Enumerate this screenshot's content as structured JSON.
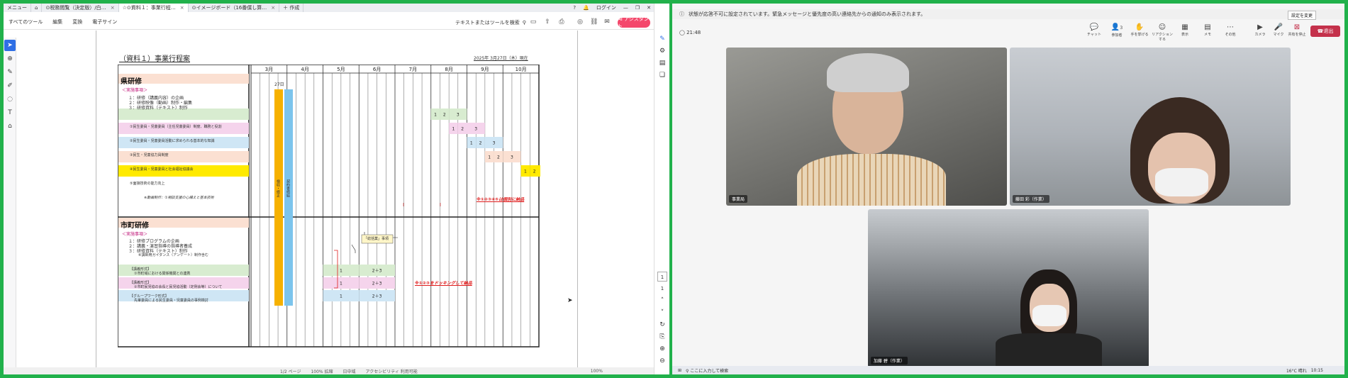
{
  "pdf": {
    "tabs": [
      {
        "label": "メニュー",
        "active": false
      },
      {
        "label": "⊙税務閲覧（決定版）/白…",
        "active": false
      },
      {
        "label": "⊙資料１：事業行程…",
        "active": true
      },
      {
        "label": "⊙イメージボード（16番僕し算…",
        "active": false
      },
      {
        "label": "＋ 作成",
        "active": false
      }
    ],
    "title_right": {
      "login": "ログイン",
      "help": "?"
    },
    "menu": [
      "すべてのツール",
      "編集",
      "変換",
      "電子サイン"
    ],
    "search_placeholder": "テキストまたはツールを検索",
    "ai_button": "AI アシスタント",
    "left_tools": [
      "select-arrow-icon",
      "zoom-icon",
      "pen-icon",
      "highlighter-icon",
      "lasso-icon",
      "text-box-icon",
      "stamp-icon"
    ],
    "status": {
      "page": "1/2 ページ",
      "zoom_a": "100% 拡縮",
      "zoom_b": "100%",
      "scroll": "日中域",
      "area": "アクセシビリティ 利用可能"
    },
    "page_number": "1",
    "page_total": "1",
    "document": {
      "title": "（資料１）事業行程案",
      "date": "2025年 3月27日（木）現在",
      "months": [
        "3月",
        "4月",
        "5月",
        "6月",
        "7月",
        "8月",
        "9月",
        "10月"
      ],
      "marker": "27日",
      "section_a": {
        "title": "県研修",
        "sub": "＜実施事項＞",
        "items": [
          "１：研修（講義内容）の企画",
          "２：研修映像（動画）制作・編集",
          "３：研修資料（テキスト）制作"
        ],
        "rows": [
          {
            "label": "①民生委員・児童委員（主任児童委員）制度、職務と役割",
            "steps": [
              "1",
              "2",
              "3"
            ]
          },
          {
            "label": "②民生委員・児童委員活動に求められる基本的な知識",
            "steps": [
              "1",
              "2",
              "3"
            ]
          },
          {
            "label": "③民生・児童協力員制度",
            "steps": [
              "1",
              "2",
              "3"
            ]
          },
          {
            "label": "④民生委員・児童委員と社会福祉協議会",
            "steps": [
              "1",
              "2",
              "3"
            ]
          },
          {
            "label": "⑤面接技術の能力向上",
            "steps": [
              "1",
              "2",
              "3"
            ]
          }
        ],
        "note": "※動画制作：①相談支援の心構えと基本技術",
        "red_note": "※①②③④⑤は個別に納品"
      },
      "section_b": {
        "title": "市町研修",
        "sub": "＜実施事項＞",
        "items": [
          "１：研修プログラムの企画",
          "２：講義・演習指導の指導者養成",
          "３：研修資料（テキスト）制作"
        ],
        "items_note": "⑥講師用ガイダンス（アンケート）制作含む",
        "callout": "「総括業」事項",
        "rows": [
          {
            "title": "【講義形式】",
            "label": "①市町域における関係機関との連携",
            "steps": [
              "1",
              "2＋3"
            ]
          },
          {
            "title": "【講義形式】",
            "label": "②市町民児協の会長と民児協活動（定例会等）について",
            "steps": [
              "1",
              "2＋3"
            ]
          },
          {
            "title": "【グループワーク形式】",
            "label": "先輩委員による民生委員・児童委員の事例検討",
            "steps": [
              "1",
              "2＋3"
            ]
          }
        ],
        "red_note": "※①②③をドッキングして納品"
      },
      "bars": {
        "a": "検収・修正",
        "b": "契約書締結"
      }
    }
  },
  "teams": {
    "notice": "状態が応答不可に設定されています。緊急メッセージと優先度の高い連絡先からの通知のみ表示されます。",
    "notice_button": "設定を変更",
    "timer": "21:48",
    "controls": [
      {
        "label": "チャット",
        "icon": "chat-icon"
      },
      {
        "label": "参加者",
        "icon": "people-icon"
      },
      {
        "label": "手を挙げる",
        "icon": "hand-icon"
      },
      {
        "label": "リアクションする",
        "icon": "smile-icon"
      },
      {
        "label": "表示",
        "icon": "grid-icon"
      },
      {
        "label": "メモ",
        "icon": "note-icon"
      },
      {
        "label": "その他",
        "icon": "more-icon"
      },
      {
        "label": "カメラ",
        "icon": "camera-icon"
      },
      {
        "label": "マイク",
        "icon": "mic-icon"
      },
      {
        "label": "共有を停止",
        "icon": "share-stop-icon"
      }
    ],
    "participant_count": "3",
    "leave": "退出",
    "participants": [
      {
        "name": "事業局"
      },
      {
        "name": "藤田 彩（作業）"
      },
      {
        "name": "加藤 碧（作業）"
      }
    ]
  },
  "taskbar": {
    "search": "ここに入力して検索",
    "time": "10:15",
    "weather": "16°C 晴れ"
  }
}
